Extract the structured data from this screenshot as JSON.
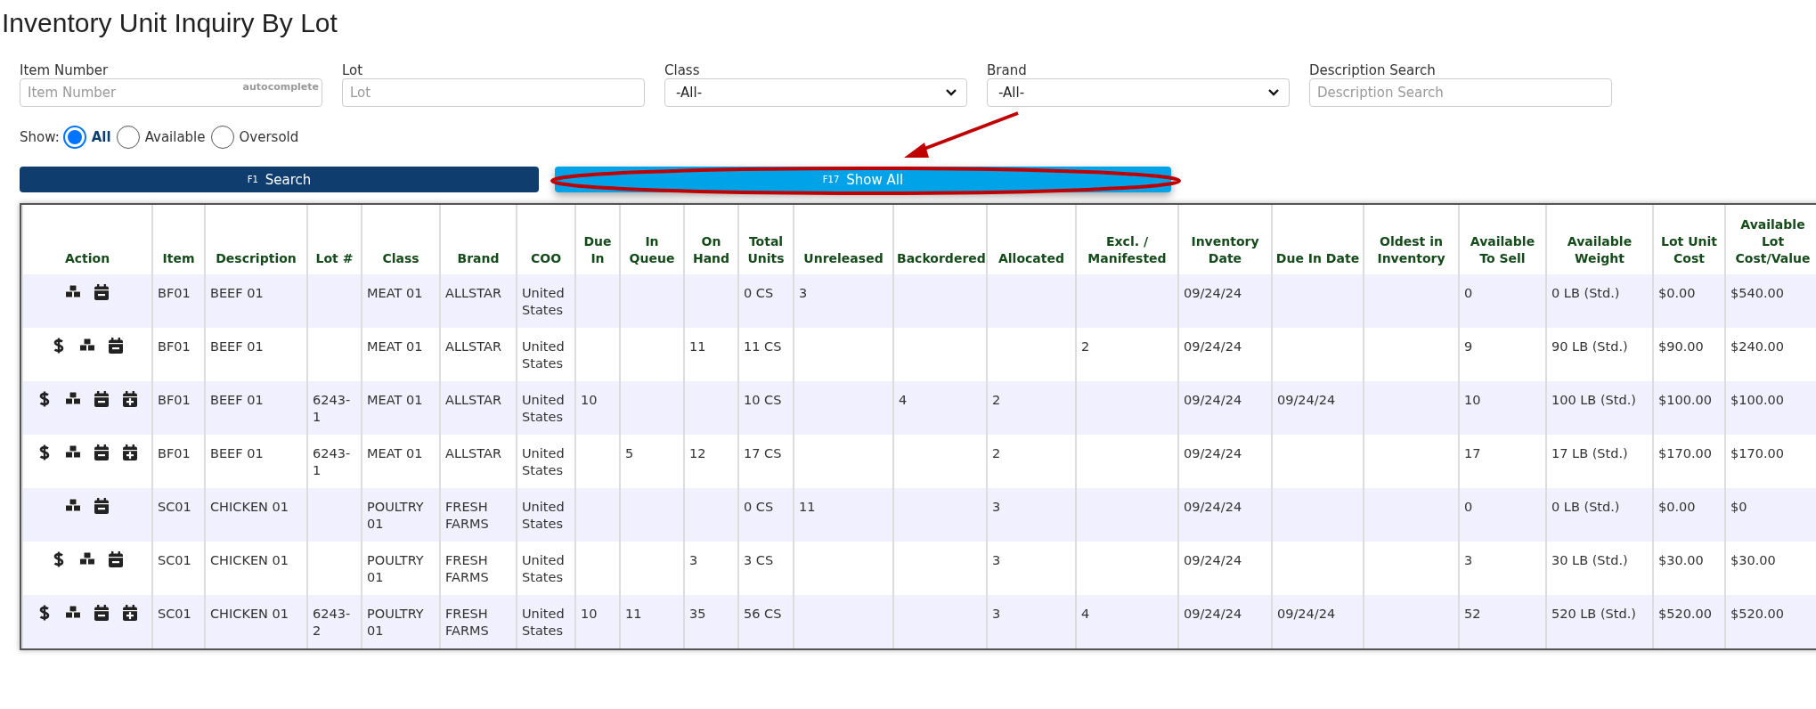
{
  "page": {
    "title": "Inventory Unit Inquiry By Lot"
  },
  "filters": [
    {
      "kind": "text",
      "label": "Item Number",
      "placeholder": "Item Number",
      "hint": "autocomplete"
    },
    {
      "kind": "text",
      "label": "Lot",
      "placeholder": "Lot"
    },
    {
      "kind": "select",
      "label": "Class",
      "value": "-All-"
    },
    {
      "kind": "select",
      "label": "Brand",
      "value": "-All-"
    },
    {
      "kind": "text",
      "label": "Description Search",
      "placeholder": "Description Search"
    }
  ],
  "show": {
    "label": "Show:",
    "options": [
      {
        "label": "All",
        "selected": true
      },
      {
        "label": "Available",
        "selected": false
      },
      {
        "label": "Oversold",
        "selected": false
      }
    ]
  },
  "buttons": [
    {
      "kind": "primary",
      "key": "F1",
      "label": "Search"
    },
    {
      "kind": "secondary",
      "key": "F17",
      "label": "Show All"
    }
  ],
  "table": {
    "columns": [
      "Action",
      "Item",
      "Description",
      "Lot #",
      "Class",
      "Brand",
      "COO",
      "Due In",
      "In Queue",
      "On Hand",
      "Total Units",
      "Unreleased",
      "Backordered",
      "Allocated",
      "Excl. / Manifested",
      "Inventory Date",
      "Due In Date",
      "Oldest in Inventory",
      "Available To Sell",
      "Available Weight",
      "Lot Unit Cost",
      "Available Lot Cost/Value"
    ],
    "rows": [
      {
        "cells": [
          {
            "actions": [
              {
                "kind": "boxes"
              },
              {
                "kind": "calendar-minus"
              }
            ]
          },
          "BF01",
          "BEEF 01",
          "",
          "MEAT 01",
          "ALLSTAR",
          "United States",
          "",
          "",
          "",
          "0 CS",
          "3",
          "",
          "",
          "",
          "09/24/24",
          "",
          "",
          "0",
          "0 LB (Std.)",
          "$0.00",
          "$540.00"
        ]
      },
      {
        "cells": [
          {
            "actions": [
              {
                "kind": "dollar"
              },
              {
                "kind": "boxes"
              },
              {
                "kind": "calendar-minus"
              }
            ]
          },
          "BF01",
          "BEEF 01",
          "",
          "MEAT 01",
          "ALLSTAR",
          "United States",
          "",
          "",
          "11",
          "11 CS",
          "",
          "",
          "",
          "2",
          "09/24/24",
          "",
          "",
          "9",
          "90 LB (Std.)",
          "$90.00",
          "$240.00"
        ]
      },
      {
        "cells": [
          {
            "actions": [
              {
                "kind": "dollar"
              },
              {
                "kind": "boxes"
              },
              {
                "kind": "calendar-minus"
              },
              {
                "kind": "calendar-plus"
              }
            ]
          },
          "BF01",
          "BEEF 01",
          "6243-1",
          "MEAT 01",
          "ALLSTAR",
          "United States",
          "10",
          "",
          "",
          "10 CS",
          "",
          "4",
          "2",
          "",
          "09/24/24",
          "09/24/24",
          "",
          "10",
          "100 LB (Std.)",
          "$100.00",
          "$100.00"
        ]
      },
      {
        "cells": [
          {
            "actions": [
              {
                "kind": "dollar"
              },
              {
                "kind": "boxes"
              },
              {
                "kind": "calendar-minus"
              },
              {
                "kind": "calendar-plus"
              }
            ]
          },
          "BF01",
          "BEEF 01",
          "6243-1",
          "MEAT 01",
          "ALLSTAR",
          "United States",
          "",
          "5",
          "12",
          "17 CS",
          "",
          "",
          "2",
          "",
          "09/24/24",
          "",
          "",
          "17",
          "17 LB (Std.)",
          "$170.00",
          "$170.00"
        ]
      },
      {
        "cells": [
          {
            "actions": [
              {
                "kind": "boxes"
              },
              {
                "kind": "calendar-minus"
              }
            ]
          },
          "SC01",
          "CHICKEN 01",
          "",
          "POULTRY 01",
          "FRESH FARMS",
          "United States",
          "",
          "",
          "",
          "0 CS",
          "11",
          "",
          "3",
          "",
          "09/24/24",
          "",
          "",
          "0",
          "0 LB (Std.)",
          "$0.00",
          "$0"
        ]
      },
      {
        "cells": [
          {
            "actions": [
              {
                "kind": "dollar"
              },
              {
                "kind": "boxes"
              },
              {
                "kind": "calendar-minus"
              }
            ]
          },
          "SC01",
          "CHICKEN 01",
          "",
          "POULTRY 01",
          "FRESH FARMS",
          "United States",
          "",
          "",
          "3",
          "3 CS",
          "",
          "",
          "3",
          "",
          "09/24/24",
          "",
          "",
          "3",
          "30 LB (Std.)",
          "$30.00",
          "$30.00"
        ]
      },
      {
        "cells": [
          {
            "actions": [
              {
                "kind": "dollar"
              },
              {
                "kind": "boxes"
              },
              {
                "kind": "calendar-minus"
              },
              {
                "kind": "calendar-plus"
              }
            ]
          },
          "SC01",
          "CHICKEN 01",
          "6243-2",
          "POULTRY 01",
          "FRESH FARMS",
          "United States",
          "10",
          "11",
          "35",
          "56 CS",
          "",
          "",
          "3",
          "4",
          "09/24/24",
          "09/24/24",
          "",
          "52",
          "520 LB (Std.)",
          "$520.00",
          "$520.00"
        ]
      }
    ]
  }
}
